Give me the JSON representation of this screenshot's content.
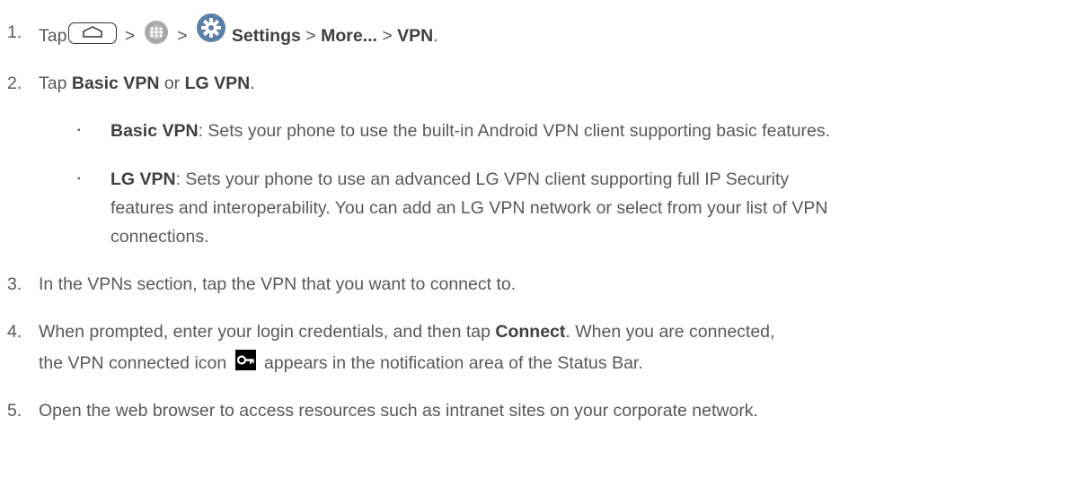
{
  "steps": {
    "s1": {
      "num": "1.",
      "tap": "Tap",
      "sep1": " > ",
      "sep2": " > ",
      "settings": "Settings",
      "sep3": " > ",
      "more": "More...",
      "sep4": " > ",
      "vpn": "VPN",
      "end": "."
    },
    "s2": {
      "num": "2.",
      "tap": "Tap ",
      "basic": "Basic VPN",
      "or": " or ",
      "lg": "LG VPN",
      "end": "."
    },
    "b1": {
      "term": "Basic VPN",
      "desc": ": Sets your phone to use the built-in Android VPN client supporting basic features."
    },
    "b2": {
      "term": "LG VPN",
      "desc1": ": Sets your phone to use an advanced LG VPN client supporting full IP Security",
      "desc2": "features and interoperability. You can add an LG VPN network or select from your list of VPN",
      "desc3": "connections."
    },
    "s3": {
      "num": "3.",
      "text": "In the VPNs section, tap the VPN that you want to connect to."
    },
    "s4": {
      "num": "4.",
      "text1": "When prompted, enter your login credentials, and then tap ",
      "connect": "Connect",
      "text2": ". When you are connected,",
      "text3": "the VPN connected icon ",
      "text4": " appears in the notification area of the Status Bar."
    },
    "s5": {
      "num": "5.",
      "text": "Open the web browser to access resources such as intranet sites on your corporate network."
    }
  },
  "icons": {
    "home": "home-key-icon",
    "apps": "apps-icon",
    "settings": "settings-gear-icon",
    "vpn_key": "vpn-key-icon"
  },
  "colors": {
    "text": "#595959",
    "bold": "#404040",
    "settings_blue": "#5b7fa6"
  }
}
